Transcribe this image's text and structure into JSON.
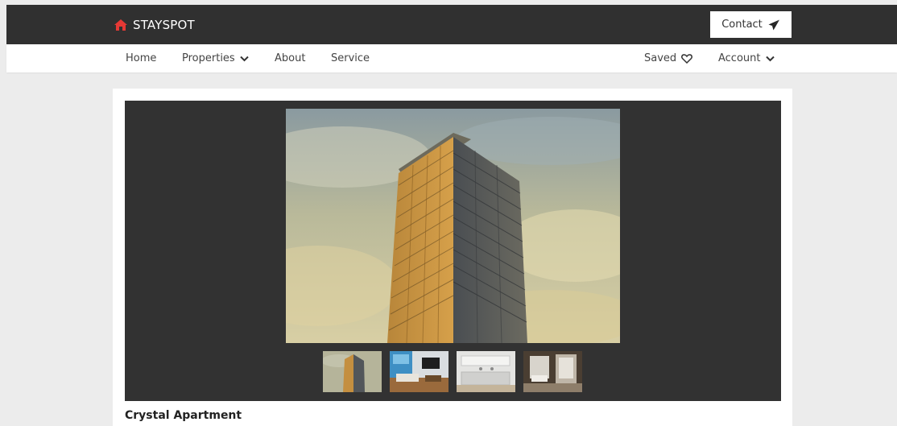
{
  "brand": {
    "name": "STAYSPOT",
    "accent": "#e53935"
  },
  "header": {
    "contact_label": "Contact"
  },
  "nav": {
    "home": "Home",
    "properties": "Properties",
    "about": "About",
    "service": "Service",
    "saved": "Saved",
    "account": "Account"
  },
  "property": {
    "title": "Crystal Apartment",
    "thumbnails": [
      "tower-exterior",
      "living-room",
      "kitchen",
      "bathroom"
    ]
  },
  "colors": {
    "header_bg": "#303030",
    "gallery_bg": "#323232",
    "page_bg": "#ececec"
  }
}
